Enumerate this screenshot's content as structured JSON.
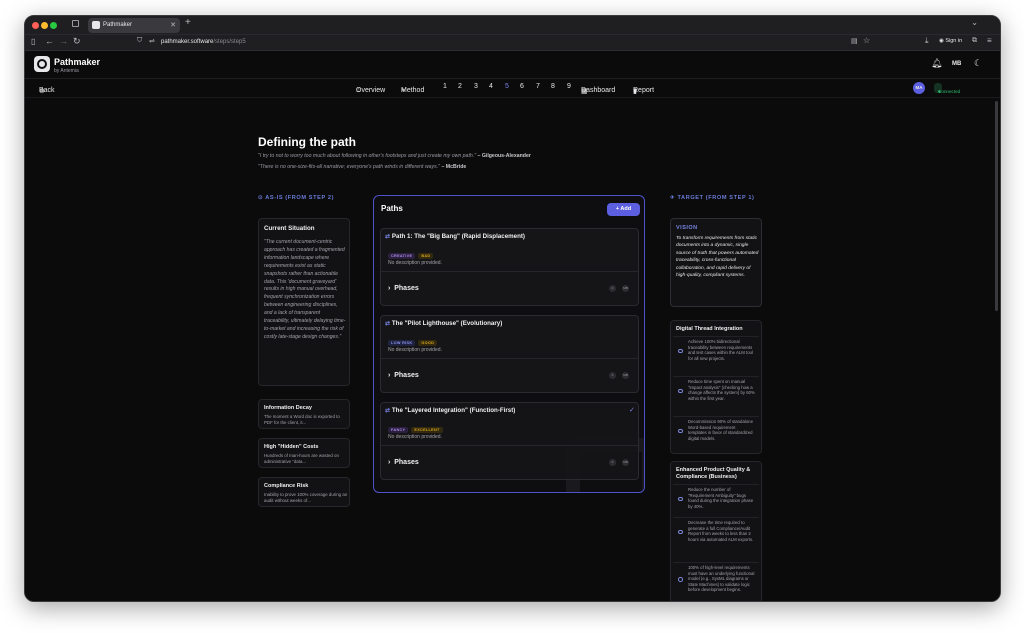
{
  "browser": {
    "tab_title": "Pathmaker",
    "url_domain": "pathmaker.software",
    "url_path": "/steps/step5",
    "sign_in": "Sign in"
  },
  "header": {
    "app_name": "Pathmaker",
    "by": "by Antemia",
    "user_initials": "MB"
  },
  "nav": {
    "back": "Back",
    "overview": "Overview",
    "method": "Method",
    "steps": [
      "1",
      "2",
      "3",
      "4",
      "5",
      "6",
      "7",
      "8",
      "9"
    ],
    "active_step": "5",
    "dashboard": "Dashboard",
    "report": "Report",
    "avatar": "MA",
    "status": "Connected"
  },
  "page": {
    "title": "Defining the path",
    "quote1": "\"I try to not to worry too much about following in other's footsteps and just create my own path.\"",
    "quote1_author": "– Gilgeous-Alexander",
    "quote2": "\"There is no one-size-fits-all narrative; everyone's path winds in different ways.\"",
    "quote2_author": "– McBride"
  },
  "as_is": {
    "heading": "AS-IS (FROM STEP 2)",
    "current_title": "Current Situation",
    "current_text": "\"The current document-centric approach has created a fragmented information landscape where requirements exist as static snapshots rather than actionable data. This 'document graveyard' results in high manual overhead, frequent synchronization errors between engineering disciplines, and a lack of transparent traceability, ultimately delaying time-to-market and increasing the risk of costly late-stage design changes.\"",
    "items": [
      {
        "title": "Information Decay",
        "text": "The moment a Word doc is exported to PDF for the client, it..."
      },
      {
        "title": "High \"Hidden\" Costs",
        "text": "Hundreds of man-hours are wasted on administrative \"data..."
      },
      {
        "title": "Compliance Risk",
        "text": "Inability to prove 100% coverage during an audit without weeks of..."
      }
    ]
  },
  "paths": {
    "heading": "Paths",
    "add": "Add",
    "phases_label": "Phases",
    "list": [
      {
        "title": "Path 1: The \"Big Bang\" (Rapid Displacement)",
        "tag1": "CREATIVE",
        "tag2": "BAD",
        "description": "No description provided.",
        "dots": [
          "0",
          "MB"
        ]
      },
      {
        "title": "The \"Pilot Lighthouse\" (Evolutionary)",
        "tag1": "LOW RISK",
        "tag2": "GOOD",
        "description": "No description provided.",
        "dots": [
          "0",
          "MB"
        ]
      },
      {
        "title": "The \"Layered Integration\" (Function-First)",
        "tag1": "FANCY",
        "tag2": "EXCELLENT",
        "description": "No description provided.",
        "dots": [
          "0",
          "MB"
        ]
      }
    ]
  },
  "target": {
    "heading": "TARGET (FROM STEP 1)",
    "vision_label": "VISION",
    "vision_text": "To transform requirements from static documents into a dynamic, single source of truth that powers automated traceability, cross-functional collaboration, and rapid delivery of high-quality, compliant systems.",
    "groups": [
      {
        "title": "Digital Thread Integration",
        "goals": [
          "Achieve 100% bidirectional traceability between requirements and test cases within the ALM tool for all new projects.",
          "Reduce time spent on manual \"impact analysis\" (checking how a change affects the system) by 60% within the first year.",
          "Decommission 90% of standalone Word-based requirement templates in favor of standardized digital models."
        ]
      },
      {
        "title": "Enhanced Product Quality & Compliance (Business)",
        "goals": [
          "Reduce the number of \"Requirement Ambiguity\" bugs found during the integration phase by 40%.",
          "Decrease the time required to generate a full Compliance/Audit Report from weeks to less than 2 hours via automated ALM exports.",
          "100% of high-level requirements must have an underlying functional model (e.g., SysML diagrams or State Machines) to validate logic before development begins."
        ]
      }
    ]
  },
  "colors": {
    "accent": "#5b5fe0",
    "connected": "#2fbf71",
    "bad": "#d4a017",
    "creative": "#a77be8"
  }
}
